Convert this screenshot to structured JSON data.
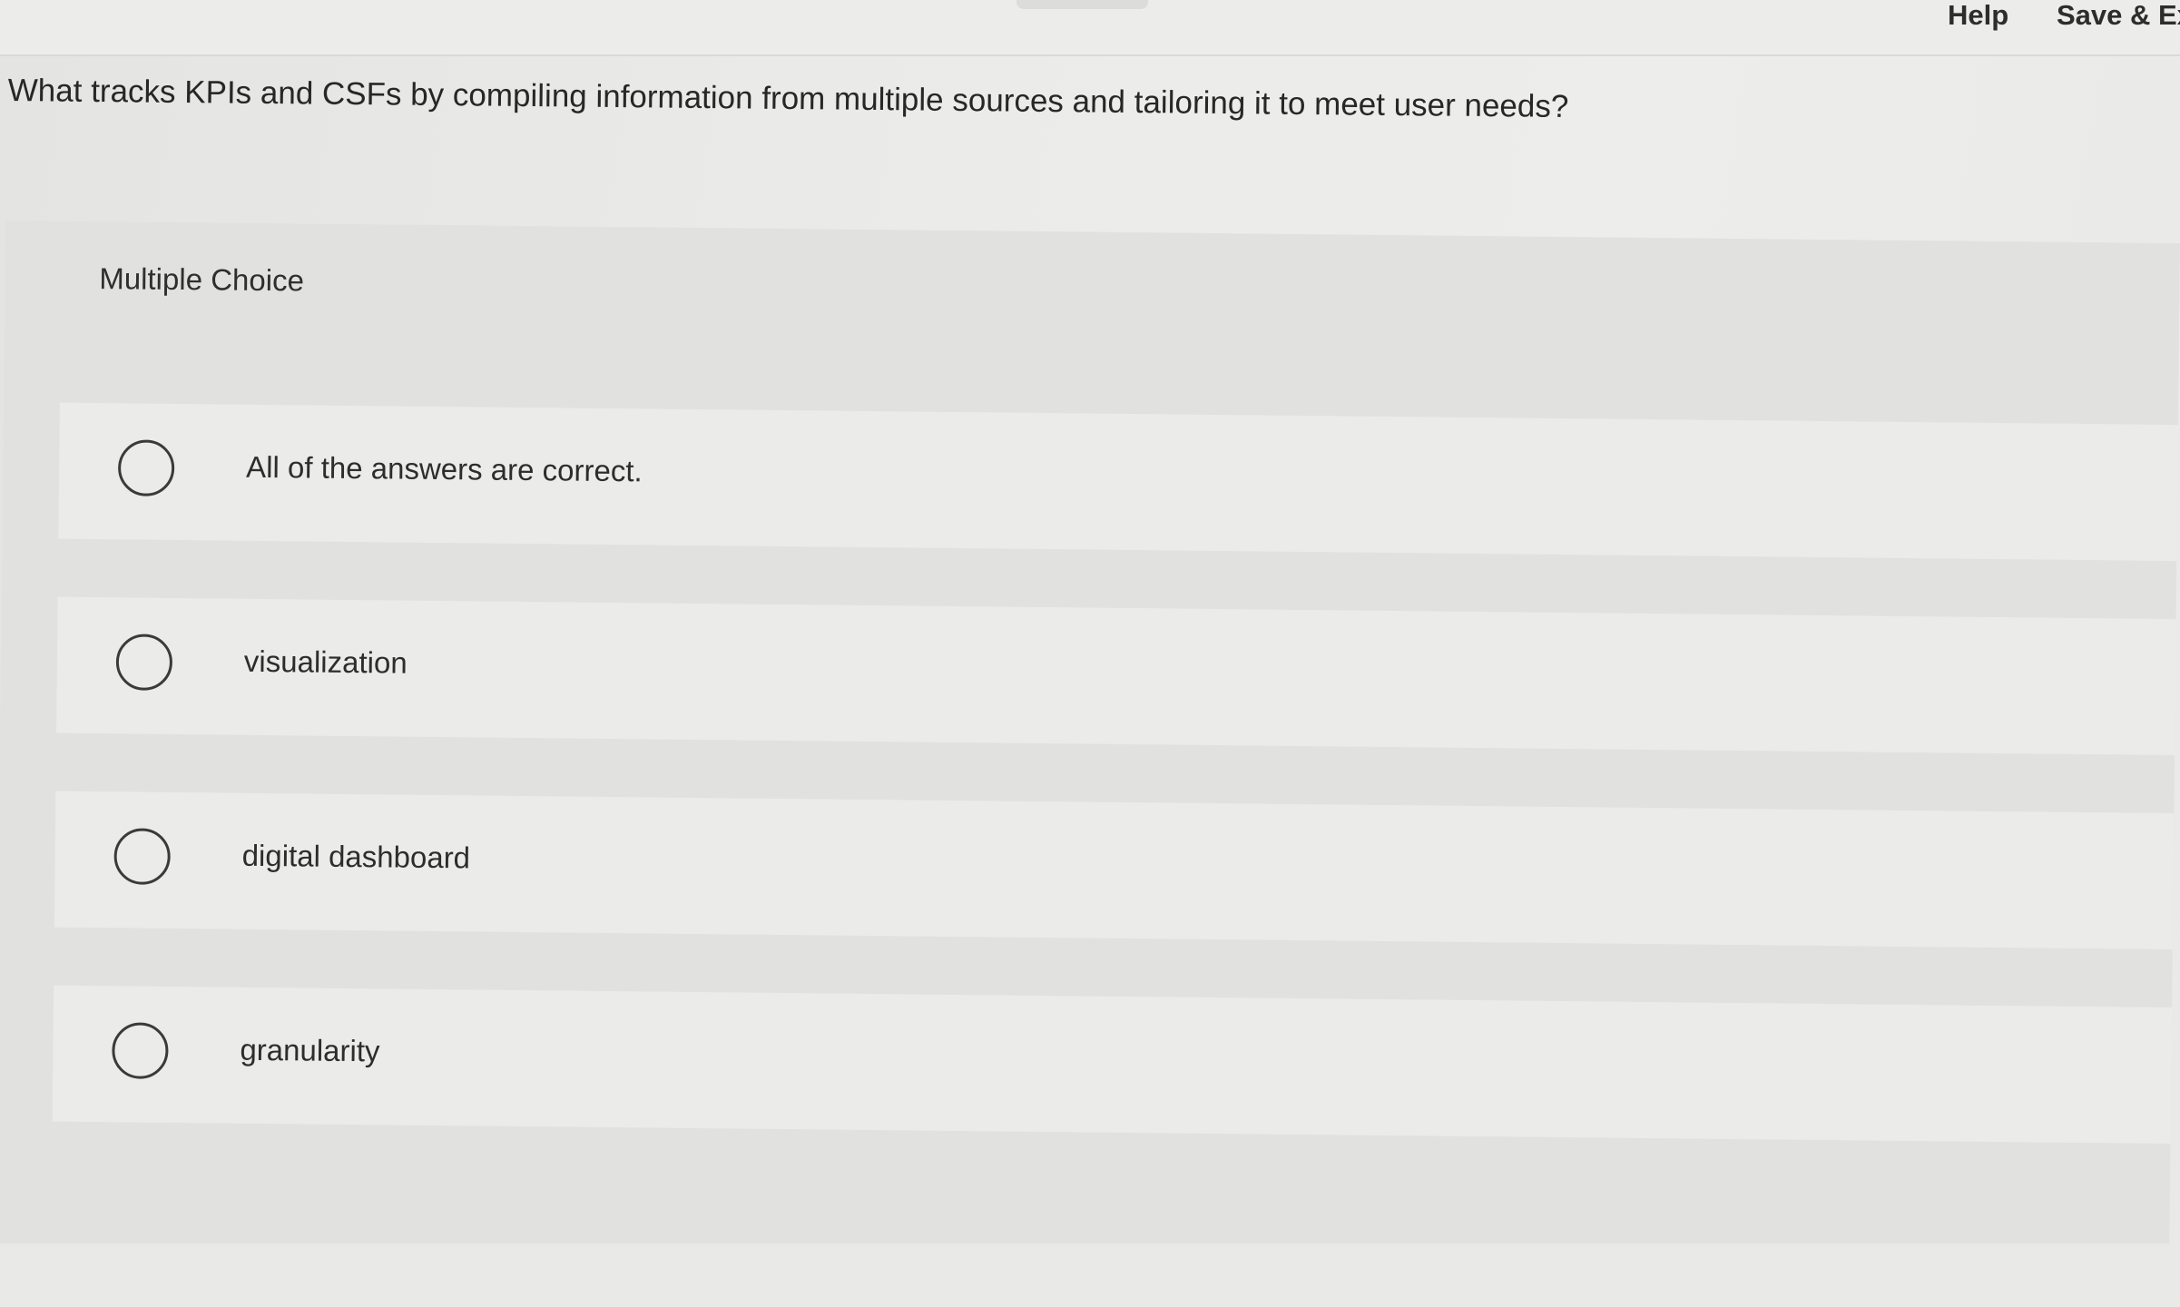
{
  "header": {
    "help_label": "Help",
    "save_exit_label": "Save & Ex"
  },
  "question": {
    "text": "What tracks KPIs and CSFs by compiling information from multiple sources and tailoring it to meet user needs?"
  },
  "answer_panel": {
    "type_label": "Multiple Choice",
    "options": [
      {
        "label": "All of the answers are correct.",
        "selected": false
      },
      {
        "label": "visualization",
        "selected": false
      },
      {
        "label": "digital dashboard",
        "selected": false
      },
      {
        "label": "granularity",
        "selected": false
      }
    ]
  }
}
